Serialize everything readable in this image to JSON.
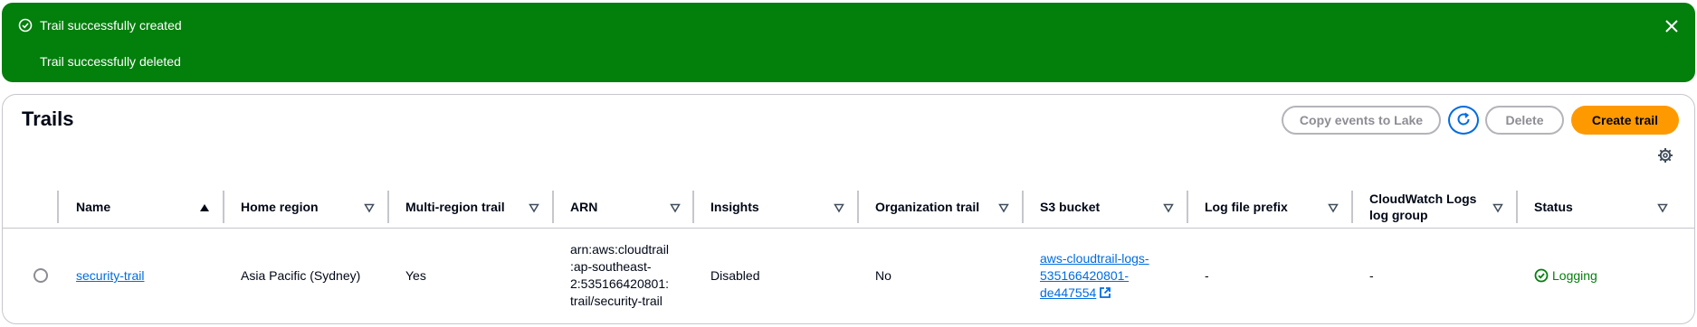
{
  "flash": {
    "message_1": "Trail successfully created",
    "message_2": "Trail successfully deleted",
    "icon": "check-circle-icon",
    "close_icon": "close-icon",
    "background": "#037f0c"
  },
  "panel": {
    "title": "Trails",
    "buttons": {
      "copy_events": "Copy events to Lake",
      "refresh_icon": "refresh-icon",
      "delete": "Delete",
      "create": "Create trail"
    },
    "settings_icon": "gear-icon",
    "accent": "#ff9900"
  },
  "table": {
    "columns": [
      "Name",
      "Home region",
      "Multi-region trail",
      "ARN",
      "Insights",
      "Organization trail",
      "S3 bucket",
      "Log file prefix",
      "CloudWatch Logs log group",
      "Status"
    ],
    "rows": [
      {
        "name": "security-trail",
        "home_region": "Asia Pacific (Sydney)",
        "multi_region": "Yes",
        "arn_lines": [
          "arn:aws:cloudtrail",
          ":ap-southeast-",
          "2:535166420801:",
          "trail/security-trail"
        ],
        "insights": "Disabled",
        "organization_trail": "No",
        "s3_lines": [
          "aws-cloudtrail-logs-",
          "535166420801-",
          "de447554"
        ],
        "log_file_prefix": "-",
        "cloudwatch_log_group": "-",
        "status": "Logging"
      }
    ]
  }
}
